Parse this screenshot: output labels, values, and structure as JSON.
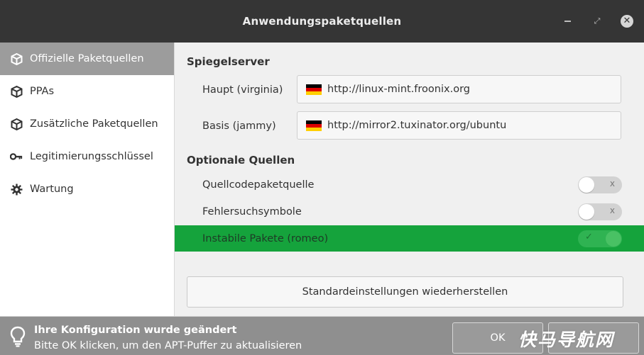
{
  "window": {
    "title": "Anwendungspaketquellen",
    "controls": {
      "minimize": "minimize-icon",
      "maximize": "maximize-icon",
      "close": "close-icon"
    }
  },
  "sidebar": {
    "items": [
      {
        "label": "Offizielle Paketquellen",
        "icon": "package-icon",
        "active": true
      },
      {
        "label": "PPAs",
        "icon": "package-icon",
        "active": false
      },
      {
        "label": "Zusätzliche Paketquellen",
        "icon": "package-icon",
        "active": false
      },
      {
        "label": "Legitimierungsschlüssel",
        "icon": "key-icon",
        "active": false
      },
      {
        "label": "Wartung",
        "icon": "gear-icon",
        "active": false
      }
    ]
  },
  "main": {
    "mirrors_title": "Spiegelserver",
    "mirrors": [
      {
        "label": "Haupt (virginia)",
        "url": "http://linux-mint.froonix.org",
        "flag": "germany-flag-icon"
      },
      {
        "label": "Basis (jammy)",
        "url": "http://mirror2.tuxinator.org/ubuntu",
        "flag": "germany-flag-icon"
      }
    ],
    "optional_title": "Optionale Quellen",
    "optional": [
      {
        "label": "Quellcodepaketquelle",
        "enabled": false,
        "mark": "x"
      },
      {
        "label": "Fehlersuchsymbole",
        "enabled": false,
        "mark": "x"
      },
      {
        "label": "Instabile Pakete (romeo)",
        "enabled": true,
        "mark": "✓"
      }
    ],
    "restore_label": "Standardeinstellungen wiederherstellen"
  },
  "status": {
    "title": "Ihre Konfiguration wurde geändert",
    "subtitle": "Bitte OK klicken, um den APT-Puffer zu aktualisieren",
    "ok_label": "OK",
    "icon": "lightbulb-icon"
  },
  "watermark": "快马导航网",
  "colors": {
    "titlebar": "#353535",
    "active_sidebar": "#9c9c9c",
    "highlight_row": "#15a33c",
    "toggle_on": "#2fb352",
    "statusbar": "#8f8f8f"
  }
}
